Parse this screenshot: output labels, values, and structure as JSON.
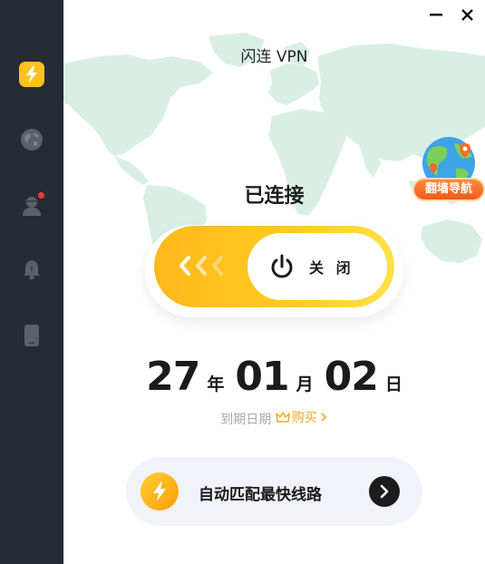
{
  "app": {
    "title": "闪连 VPN"
  },
  "sidebar": {
    "items": [
      {
        "name": "speed",
        "icon": "lightning-icon",
        "active": true
      },
      {
        "name": "globe",
        "icon": "globe-icon",
        "active": false
      },
      {
        "name": "account",
        "icon": "user-icon",
        "active": false,
        "badge": true
      },
      {
        "name": "notifications",
        "icon": "bell-icon",
        "active": false
      },
      {
        "name": "device",
        "icon": "phone-icon",
        "active": false
      }
    ]
  },
  "badge": {
    "label": "翻墙导航",
    "icon": "globe-map-icon"
  },
  "status": {
    "text": "已连接"
  },
  "toggle": {
    "label": "关 闭",
    "icon": "power-icon"
  },
  "expiry": {
    "year": "27",
    "year_unit": "年",
    "month": "01",
    "month_unit": "月",
    "day": "02",
    "day_unit": "日",
    "label": "到期日期",
    "buy_label": "购买"
  },
  "route": {
    "label": "自动匹配最快线路",
    "icon": "lightning-icon",
    "arrow_icon": "chevron-right-icon"
  },
  "colors": {
    "sidebar_bg": "#262b35",
    "accent": "#ffc21f",
    "map_land": "#d9efe6",
    "buy_link": "#f6a72a",
    "route_bg": "#f2f2fa"
  }
}
